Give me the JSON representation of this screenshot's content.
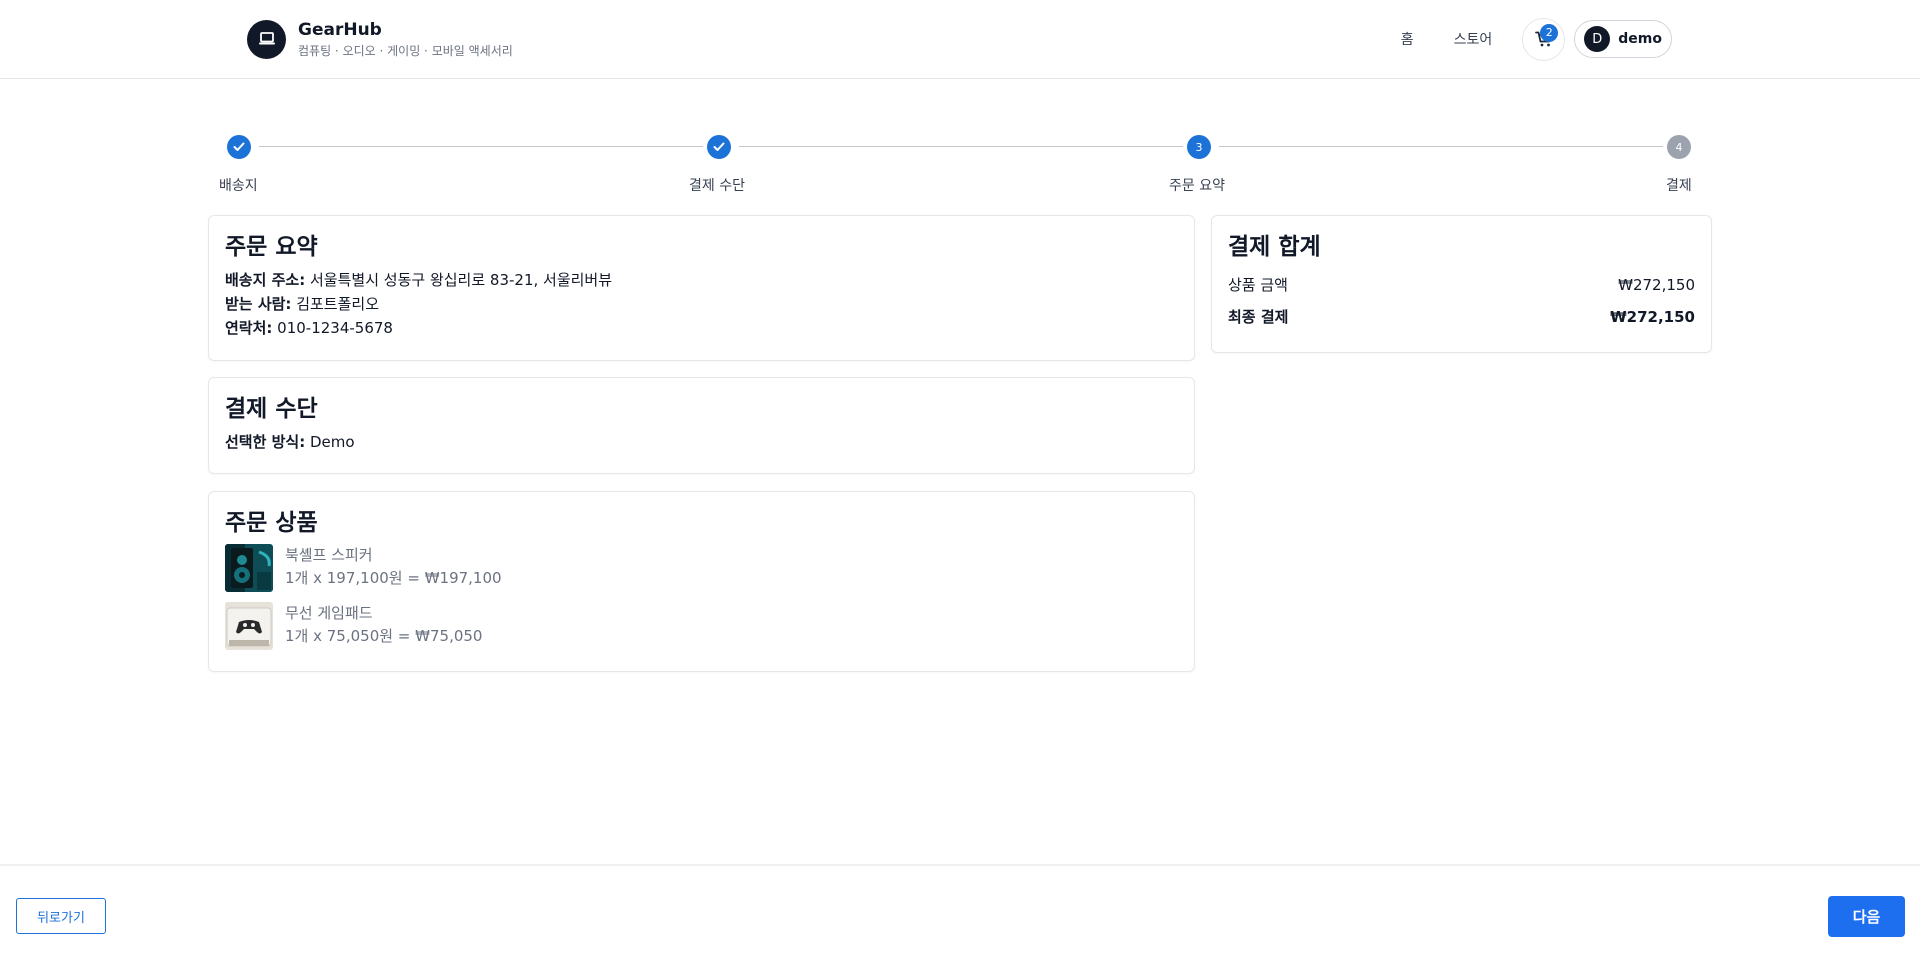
{
  "header": {
    "brand_name": "GearHub",
    "brand_subtitle": "컴퓨팅 · 오디오 · 게이밍 · 모바일 액세서리",
    "nav": [
      {
        "label": "홈"
      },
      {
        "label": "스토어"
      }
    ],
    "cart_count": "2",
    "user": {
      "initial": "D",
      "name": "demo"
    }
  },
  "stepper": {
    "steps": [
      {
        "label": "배송지",
        "status": "done",
        "number": "1"
      },
      {
        "label": "결제 수단",
        "status": "done",
        "number": "2"
      },
      {
        "label": "주문 요약",
        "status": "active",
        "number": "3"
      },
      {
        "label": "결제",
        "status": "pending",
        "number": "4"
      }
    ]
  },
  "summary": {
    "title": "주문 요약",
    "address_label": "배송지 주소:",
    "address": " 서울특별시 성동구 왕십리로 83-21, 서울리버뷰",
    "recipient_label": "받는 사람:",
    "recipient": " 김포트폴리오",
    "phone_label": "연락처:",
    "phone": " 010-1234-5678"
  },
  "payment": {
    "title": "결제 수단",
    "method_label": "선택한 방식:",
    "method": " Demo"
  },
  "items": {
    "title": "주문 상품",
    "list": [
      {
        "name": "북셸프 스피커",
        "price_line": "1개 x 197,100원 = ₩197,100"
      },
      {
        "name": "무선 게임패드",
        "price_line": "1개 x 75,050원 = ₩75,050"
      }
    ]
  },
  "totals": {
    "title": "결제 합계",
    "subtotal_label": "상품 금액",
    "subtotal": "₩272,150",
    "final_label": "최종 결제",
    "final": "₩272,150"
  },
  "footer": {
    "back_label": "뒤로가기",
    "next_label": "다음"
  },
  "colors": {
    "accent": "#1d72d8",
    "primary_button": "#1d6ff0",
    "pending_step": "#9ca3af"
  }
}
